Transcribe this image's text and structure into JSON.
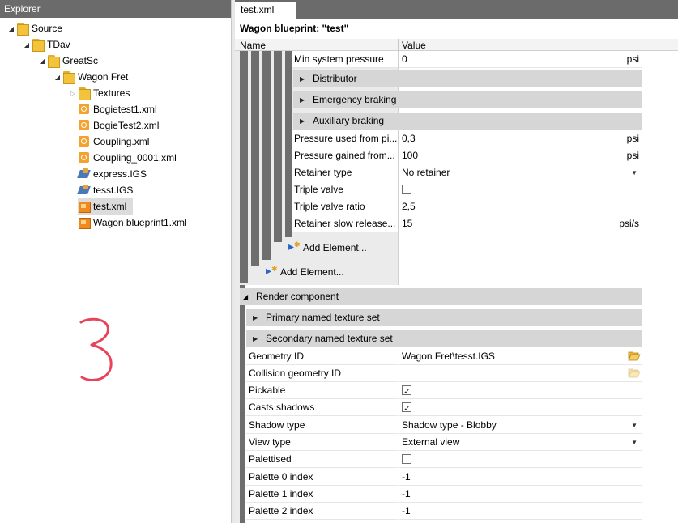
{
  "explorer": {
    "title": "Explorer",
    "tree": [
      {
        "label": "Source",
        "type": "folder",
        "expanded": true
      },
      {
        "label": "TDav",
        "type": "folder",
        "expanded": true
      },
      {
        "label": "GreatSc",
        "type": "folder",
        "expanded": true
      },
      {
        "label": "Wagon Fret",
        "type": "folder",
        "expanded": true
      },
      {
        "label": "Textures",
        "type": "folder",
        "expanded": false
      },
      {
        "label": "Bogietest1.xml",
        "type": "xml-file"
      },
      {
        "label": "BogieTest2.xml",
        "type": "xml-file"
      },
      {
        "label": "Coupling.xml",
        "type": "xml-file"
      },
      {
        "label": "Coupling_0001.xml",
        "type": "xml-file"
      },
      {
        "label": "express.IGS",
        "type": "igs-file"
      },
      {
        "label": "tesst.IGS",
        "type": "igs-file"
      },
      {
        "label": "test.xml",
        "type": "blueprint-file",
        "selected": true
      },
      {
        "label": "Wagon blueprint1.xml",
        "type": "blueprint-file"
      }
    ],
    "drawing_color": "#e8435a"
  },
  "editor": {
    "tab_label": "test.xml",
    "doc_title": "Wagon blueprint: \"test\"",
    "columns": {
      "name": "Name",
      "value": "Value"
    },
    "brake_props_top": [
      {
        "name": "Min system pressure",
        "value": "0",
        "unit": "psi"
      }
    ],
    "brake_groups": [
      "Distributor",
      "Emergency braking",
      "Auxiliary braking"
    ],
    "brake_props": [
      {
        "name": "Pressure used from pi...",
        "value": "0,3",
        "unit": "psi"
      },
      {
        "name": "Pressure gained from...",
        "value": "100",
        "unit": "psi"
      },
      {
        "name": "Retainer type",
        "value": "No retainer",
        "dropdown": true
      },
      {
        "name": "Triple valve",
        "checkbox": true,
        "checked": false
      },
      {
        "name": "Triple valve ratio",
        "value": "2,5"
      },
      {
        "name": "Retainer slow release...",
        "value": "15",
        "unit": "psi/s"
      }
    ],
    "add_element_label": "Add Element...",
    "render_component": {
      "header": "Render component",
      "groups": [
        "Primary named texture set",
        "Secondary named texture set"
      ],
      "props": [
        {
          "name": "Geometry ID",
          "value": "Wagon Fret\\tesst.IGS",
          "folder": true
        },
        {
          "name": "Collision geometry ID",
          "value": "",
          "folder": true,
          "disabled": true
        },
        {
          "name": "Pickable",
          "checkbox": true,
          "checked": true
        },
        {
          "name": "Casts shadows",
          "checkbox": true,
          "checked": true
        },
        {
          "name": "Shadow type",
          "value": "Shadow type - Blobby",
          "dropdown": true
        },
        {
          "name": "View type",
          "value": "External view",
          "dropdown": true
        },
        {
          "name": "Palettised",
          "checkbox": true,
          "checked": false
        },
        {
          "name": "Palette 0 index",
          "value": "-1"
        },
        {
          "name": "Palette 1 index",
          "value": "-1"
        },
        {
          "name": "Palette 2 index",
          "value": "-1"
        }
      ]
    }
  },
  "colors": {
    "header_gray": "#6b6b6b",
    "group_gray": "#d6d6d6",
    "indent_bar": "#6e6e6e"
  }
}
